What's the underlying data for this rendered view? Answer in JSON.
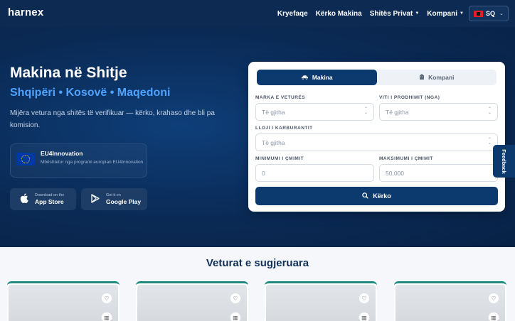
{
  "nav": {
    "logo": "harnex",
    "links": [
      {
        "label": "Kryefaqe",
        "caret": false
      },
      {
        "label": "Kërko Makina",
        "caret": false
      },
      {
        "label": "Shitës Privat",
        "caret": true
      },
      {
        "label": "Kompani",
        "caret": true
      }
    ],
    "language": "SQ"
  },
  "hero": {
    "title": "Makina në Shitje",
    "subtitle": "Shqipëri • Kosovë • Maqedoni",
    "description": "Mijëra vetura nga shitës të verifikuar — kërko, krahaso dhe bli pa komision.",
    "eu": {
      "name": "EU4Innovation",
      "description": "Mbështetur nga programi europian EU4Innovation"
    },
    "stores": [
      {
        "small": "Download on the",
        "large": "App Store",
        "icon": "apple-icon"
      },
      {
        "small": "Get it on",
        "large": "Google Play",
        "icon": "google-play-icon"
      }
    ]
  },
  "search": {
    "tabs": [
      {
        "label": "Makina",
        "icon": "car-icon",
        "active": true
      },
      {
        "label": "Kompani",
        "icon": "building-icon",
        "active": false
      }
    ],
    "brand_label": "MARKA E VETURËS",
    "brand_value": "Të gjitha",
    "year_label": "VITI I PRODHIMIT (NGA)",
    "year_value": "Të gjitha",
    "fuel_label": "LLOJI I KARBURANTIT",
    "fuel_value": "Të gjitha",
    "min_label": "MINIMUMI I ÇMIMIT",
    "min_placeholder": "0",
    "max_label": "MAKSIMUMI I ÇMIMIT",
    "max_placeholder": "50,000",
    "button": "Kërko"
  },
  "feedback": "Feedback",
  "suggested": {
    "title": "Veturat e sugjeruara",
    "cards": [
      {},
      {},
      {},
      {}
    ]
  },
  "colors": {
    "nav": "#0d2a52",
    "accent": "#0d3a6e",
    "hero_subtitle": "#4ea2ff",
    "card_border": "#1f8a80"
  }
}
